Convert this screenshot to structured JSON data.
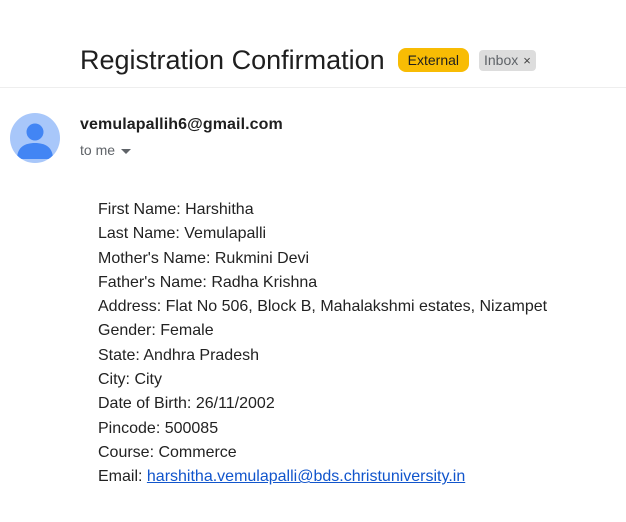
{
  "email": {
    "subject": "Registration Confirmation",
    "labels": {
      "external": "External",
      "inbox": "Inbox",
      "inbox_remove": "×"
    },
    "sender": "vemulapallih6@gmail.com",
    "recipient": "to me",
    "body": {
      "first_name": "First Name: Harshitha",
      "last_name": "Last Name: Vemulapalli",
      "mothers_name": "Mother's Name: Rukmini Devi",
      "fathers_name": "Father's Name: Radha Krishna",
      "address": "Address: Flat No 506, Block B, Mahalakshmi estates, Nizampet",
      "gender": "Gender: Female",
      "state": "State: Andhra Pradesh",
      "city": "City: City",
      "dob": "Date of Birth: 26/11/2002",
      "pincode": "Pincode: 500085",
      "course": "Course: Commerce",
      "email_label": "Email: ",
      "email_link": "harshitha.vemulapalli@bds.christuniversity.in"
    }
  },
  "colors": {
    "external_label": "#f8bc04",
    "inbox_label": "#dddddd",
    "avatar_bg": "#a8c7fa",
    "avatar_fg": "#4285f4",
    "link": "#1155cc"
  },
  "icons": {
    "avatar": "person-icon",
    "recipient_caret": "caret-down-icon",
    "label_close": "close-icon"
  }
}
